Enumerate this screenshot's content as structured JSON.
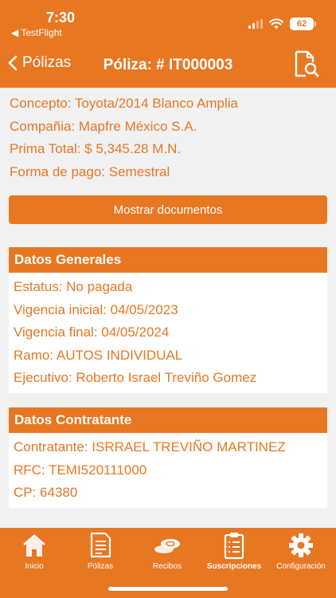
{
  "status_bar": {
    "time": "7:30",
    "back_app": "◀ TestFlight",
    "battery": "62"
  },
  "nav": {
    "back_label": "Pólizas",
    "title": "Póliza: # IT000003"
  },
  "summary": {
    "concepto": "Concepto: Toyota/2014 Blanco Amplia",
    "compania": "Compañia: Mapfre México S.A.",
    "prima": "Prima Total: $ 5,345.28 M.N.",
    "forma_pago": "Forma de pago: Semestral"
  },
  "show_docs_label": "Mostrar documentos",
  "datos_generales": {
    "title": "Datos Generales",
    "estatus": "Estatus: No pagada",
    "vigencia_inicial": "Vigencia inicial: 04/05/2023",
    "vigencia_final": "Vigencia final: 04/05/2024",
    "ramo": "Ramo: AUTOS INDIVIDUAL",
    "ejecutivo": "Ejecutivo: Roberto Israel Treviño Gomez"
  },
  "datos_contratante": {
    "title": "Datos Contratante",
    "contratante": "Contratante: ISRRAEL TREVIÑO MARTINEZ",
    "rfc": "RFC: TEMI520111000",
    "cp": "CP: 64380"
  },
  "tabs": [
    {
      "label": "Inicio",
      "icon": "home-icon",
      "active": false
    },
    {
      "label": "Pólizas",
      "icon": "document-icon",
      "active": false
    },
    {
      "label": "Recibos",
      "icon": "coins-icon",
      "active": false
    },
    {
      "label": "Suscripciones",
      "icon": "clipboard-icon",
      "active": true
    },
    {
      "label": "Configuración",
      "icon": "gear-icon",
      "active": false
    }
  ],
  "colors": {
    "accent": "#e87722",
    "background": "#f1f1f1",
    "card": "#ffffff"
  }
}
